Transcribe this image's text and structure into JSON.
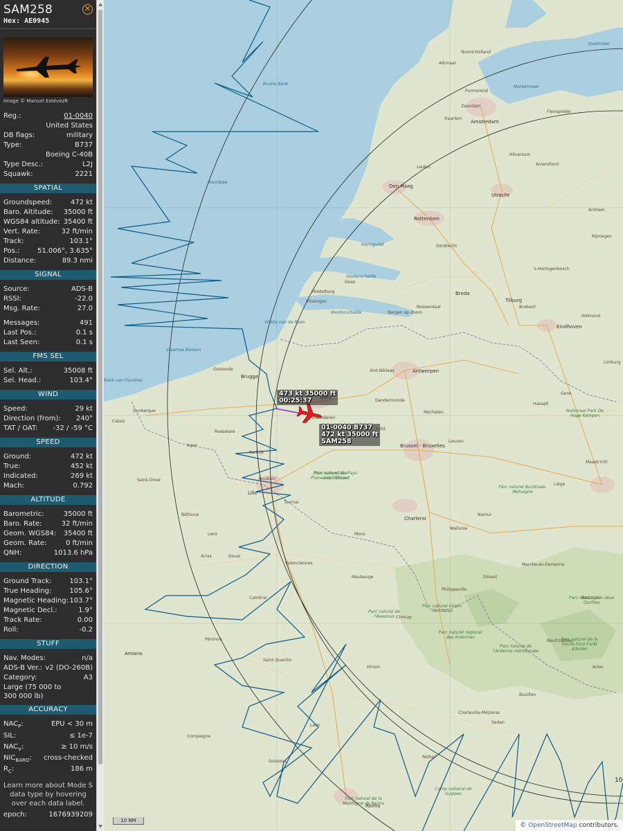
{
  "aircraft": {
    "callsign": "SAM258",
    "hex_label": "Hex:",
    "hex": "AE0945",
    "photo_credit": "Image © Manuel EstévezR",
    "map_label": {
      "speed_alt": "473 kt  35000 ft",
      "time": "00:25:37",
      "reg_type": "01-0040 B737",
      "speed_alt2": "472 kt  35000 ft",
      "callsign": "SAM258"
    }
  },
  "info": {
    "reg_label": "Reg.:",
    "reg": "01-0040",
    "country": "United States",
    "dbflags_label": "DB flags:",
    "dbflags": "military",
    "type_label": "Type:",
    "type": "B737",
    "type_full": "Boeing C-40B",
    "typedesc_label": "Type Desc.:",
    "typedesc": "L2J",
    "squawk_label": "Squawk:",
    "squawk": "2221"
  },
  "sections": {
    "spatial": "SPATIAL",
    "signal": "SIGNAL",
    "fms": "FMS SEL",
    "wind": "WIND",
    "speed": "SPEED",
    "altitude": "ALTITUDE",
    "direction": "DIRECTION",
    "stuff": "STUFF",
    "accuracy": "ACCURACY"
  },
  "spatial": [
    {
      "label": "Groundspeed:",
      "value": "472 kt"
    },
    {
      "label": "Baro. Altitude:",
      "value": "35000 ft"
    },
    {
      "label": "WGS84 altitude:",
      "value": "35400 ft"
    },
    {
      "label": "Vert. Rate:",
      "value": "32 ft/min"
    },
    {
      "label": "Track:",
      "value": "103.1°"
    },
    {
      "label": "Pos.:",
      "value": "51.006°, 3.635°"
    },
    {
      "label": "Distance:",
      "value": "89.3 nmi"
    }
  ],
  "signal": [
    {
      "label": "Source:",
      "value": "ADS-B"
    },
    {
      "label": "RSSI:",
      "value": "-22.0"
    },
    {
      "label": "Msg. Rate:",
      "value": "27.0"
    },
    {
      "label": "Messages:",
      "value": "491"
    },
    {
      "label": "Last Pos.:",
      "value": "0.1 s"
    },
    {
      "label": "Last Seen:",
      "value": "0.1 s"
    }
  ],
  "fms": [
    {
      "label": "Sel. Alt.:",
      "value": "35008 ft"
    },
    {
      "label": "Sel. Head.:",
      "value": "103.4°"
    }
  ],
  "wind": [
    {
      "label": "Speed:",
      "value": "29 kt"
    },
    {
      "label": "Direction (from):",
      "value": "240°"
    },
    {
      "label": "TAT / OAT:",
      "value": "-32 / -59 °C"
    }
  ],
  "speed": [
    {
      "label": "Ground:",
      "value": "472 kt"
    },
    {
      "label": "True:",
      "value": "452 kt"
    },
    {
      "label": "Indicated:",
      "value": "269 kt"
    },
    {
      "label": "Mach:",
      "value": "0.792"
    }
  ],
  "altitude": [
    {
      "label": "Barometric:",
      "value": "35000 ft"
    },
    {
      "label": "Baro. Rate:",
      "value": "32 ft/min"
    },
    {
      "label": "Geom. WGS84:",
      "value": "35400 ft"
    },
    {
      "label": "Geom. Rate:",
      "value": "0 ft/min"
    },
    {
      "label": "QNH:",
      "value": "1013.6 hPa"
    }
  ],
  "direction": [
    {
      "label": "Ground Track:",
      "value": "103.1°"
    },
    {
      "label": "True Heading:",
      "value": "105.6°"
    },
    {
      "label": "Magnetic Heading:",
      "value": "103.7°"
    },
    {
      "label": "Magnetic Decl.:",
      "value": "1.9°"
    },
    {
      "label": "Track Rate:",
      "value": "0.00"
    },
    {
      "label": "Roll:",
      "value": "-0.2"
    }
  ],
  "stuff": {
    "navmodes_label": "Nav. Modes:",
    "navmodes": "n/a",
    "adsbver_label": "ADS-B Ver.:",
    "adsbver": "v2 (DO-260B)",
    "category_label": "Category:",
    "category": "A3",
    "category_desc": "Large (75 000 to 300 000 lb)"
  },
  "accuracy": {
    "nacp_label": "NAC",
    "nacp_sub": "P",
    "nacp": "EPU < 30 m",
    "sil_label": "SIL:",
    "sil": "≤ 1e-7",
    "nacv_label": "NAC",
    "nacv_sub": "V",
    "nacv": "≥ 10 m/s",
    "nic_label": "NIC",
    "nic_sub": "BARO",
    "nic": "cross-checked",
    "rc_label": "R",
    "rc_sub": "C",
    "rc": "186 m"
  },
  "footer": {
    "learn": "Learn more about Mode S data type by hovering over each data label.",
    "epoch_label": "epoch:",
    "epoch": "1676939209"
  },
  "map": {
    "attribution_prefix": "© ",
    "attribution_link": "OpenStreetMap",
    "attribution_suffix": " contributors.",
    "scale": "10 NM",
    "range_ring_label": "10",
    "places": [
      {
        "name": "Amsterdam",
        "big": true
      },
      {
        "name": "Haarlem"
      },
      {
        "name": "Leiden"
      },
      {
        "name": "Den Haag",
        "big": true
      },
      {
        "name": "Rotterdam",
        "big": true
      },
      {
        "name": "Dordrecht"
      },
      {
        "name": "Utrecht",
        "big": true
      },
      {
        "name": "Amersfoort"
      },
      {
        "name": "Alkmaar"
      },
      {
        "name": "Purmerend"
      },
      {
        "name": "Zaandam"
      },
      {
        "name": "Hilversum"
      },
      {
        "name": "Breda",
        "big": true
      },
      {
        "name": "Tilburg",
        "big": true
      },
      {
        "name": "Eindhoven",
        "big": true
      },
      {
        "name": "Helmond"
      },
      {
        "name": "'s-Hertogenbosch"
      },
      {
        "name": "Nijmegen"
      },
      {
        "name": "Arnhem"
      },
      {
        "name": "Middelburg"
      },
      {
        "name": "Vlissingen"
      },
      {
        "name": "Goes"
      },
      {
        "name": "Roosendaal"
      },
      {
        "name": "Bergen op Zoom"
      },
      {
        "name": "Antwerpen",
        "big": true
      },
      {
        "name": "Mechelen"
      },
      {
        "name": "Gent",
        "big": true
      },
      {
        "name": "Brugge",
        "big": true
      },
      {
        "name": "Oostende"
      },
      {
        "name": "Kortrijk"
      },
      {
        "name": "Roeselare"
      },
      {
        "name": "Ieper"
      },
      {
        "name": "Aalst"
      },
      {
        "name": "Dendermonde"
      },
      {
        "name": "Sint-Niklaas"
      },
      {
        "name": "Brussel - Bruxelles",
        "big": true
      },
      {
        "name": "Leuven"
      },
      {
        "name": "Hasselt"
      },
      {
        "name": "Genk"
      },
      {
        "name": "Maastricht"
      },
      {
        "name": "Liège"
      },
      {
        "name": "Namur"
      },
      {
        "name": "Charleroi",
        "big": true
      },
      {
        "name": "Mons"
      },
      {
        "name": "Tournai"
      },
      {
        "name": "Lille",
        "big": true
      },
      {
        "name": "Roubaix"
      },
      {
        "name": "Dunkerque"
      },
      {
        "name": "Calais"
      },
      {
        "name": "Saint-Omer"
      },
      {
        "name": "Béthune"
      },
      {
        "name": "Lens"
      },
      {
        "name": "Douai"
      },
      {
        "name": "Arras"
      },
      {
        "name": "Cambrai"
      },
      {
        "name": "Valenciennes"
      },
      {
        "name": "Maubeuge"
      },
      {
        "name": "Saint-Quentin"
      },
      {
        "name": "Amiens",
        "big": true
      },
      {
        "name": "Laon"
      },
      {
        "name": "Soissons"
      },
      {
        "name": "Reims",
        "big": true
      },
      {
        "name": "Charleville-Mézières"
      },
      {
        "name": "Sedan"
      },
      {
        "name": "Bouillon"
      },
      {
        "name": "Dinant"
      },
      {
        "name": "Chimay"
      },
      {
        "name": "Philippeville"
      },
      {
        "name": "Marche-en-Famenne"
      },
      {
        "name": "Bastogne"
      },
      {
        "name": "Neufchâteau"
      },
      {
        "name": "Arlon"
      },
      {
        "name": "Compiègne"
      },
      {
        "name": "Péronne"
      },
      {
        "name": "Hirson"
      },
      {
        "name": "Rethel"
      },
      {
        "name": "Flevopolder"
      },
      {
        "name": "Noord-Holland"
      },
      {
        "name": "Limburg"
      },
      {
        "name": "Vlaanderen"
      },
      {
        "name": "Wallonie"
      },
      {
        "name": "Brabant"
      }
    ],
    "water_labels": [
      {
        "name": "Noordzee"
      },
      {
        "name": "Markermeer"
      },
      {
        "name": "IJsselmeer"
      },
      {
        "name": "Westerschelde"
      },
      {
        "name": "Oosterschelde"
      },
      {
        "name": "Haringvliet"
      },
      {
        "name": "Vlakte van de Raan"
      },
      {
        "name": "Bruine Bank"
      },
      {
        "name": "Vlaamse Banken"
      },
      {
        "name": "Bank van Flandres"
      }
    ],
    "park_labels": [
      {
        "name": "Parc naturel des Plaines de l'Escaut"
      },
      {
        "name": "Parc naturel de l'Avesnois"
      },
      {
        "name": "Parc naturel Viroin-Hermeton"
      },
      {
        "name": "Parc naturel régional des Ardennes"
      },
      {
        "name": "Parc naturel de l'Ardenne méridionale"
      },
      {
        "name": "Parc naturel de la Haute-Sûre Forêt d'Anlier"
      },
      {
        "name": "Parc naturel des deux Ourthes"
      },
      {
        "name": "Parc naturel Burdinale-Mehaigne"
      },
      {
        "name": "Parc naturel du Pays des Collines"
      },
      {
        "name": "Parc naturel de la Montagne de Reims"
      },
      {
        "name": "Camp national de Suippes"
      },
      {
        "name": "Nationaal Park De Hoge Kempen"
      }
    ]
  },
  "colors": {
    "sidebar_bg": "#2d2d2d",
    "section_bg": "#1e5b70",
    "sea": "#a9cfe0",
    "land": "#dfe5cf",
    "track": "#0e5a86",
    "aircraft": "#e02020",
    "close_icon": "#e8a040"
  }
}
